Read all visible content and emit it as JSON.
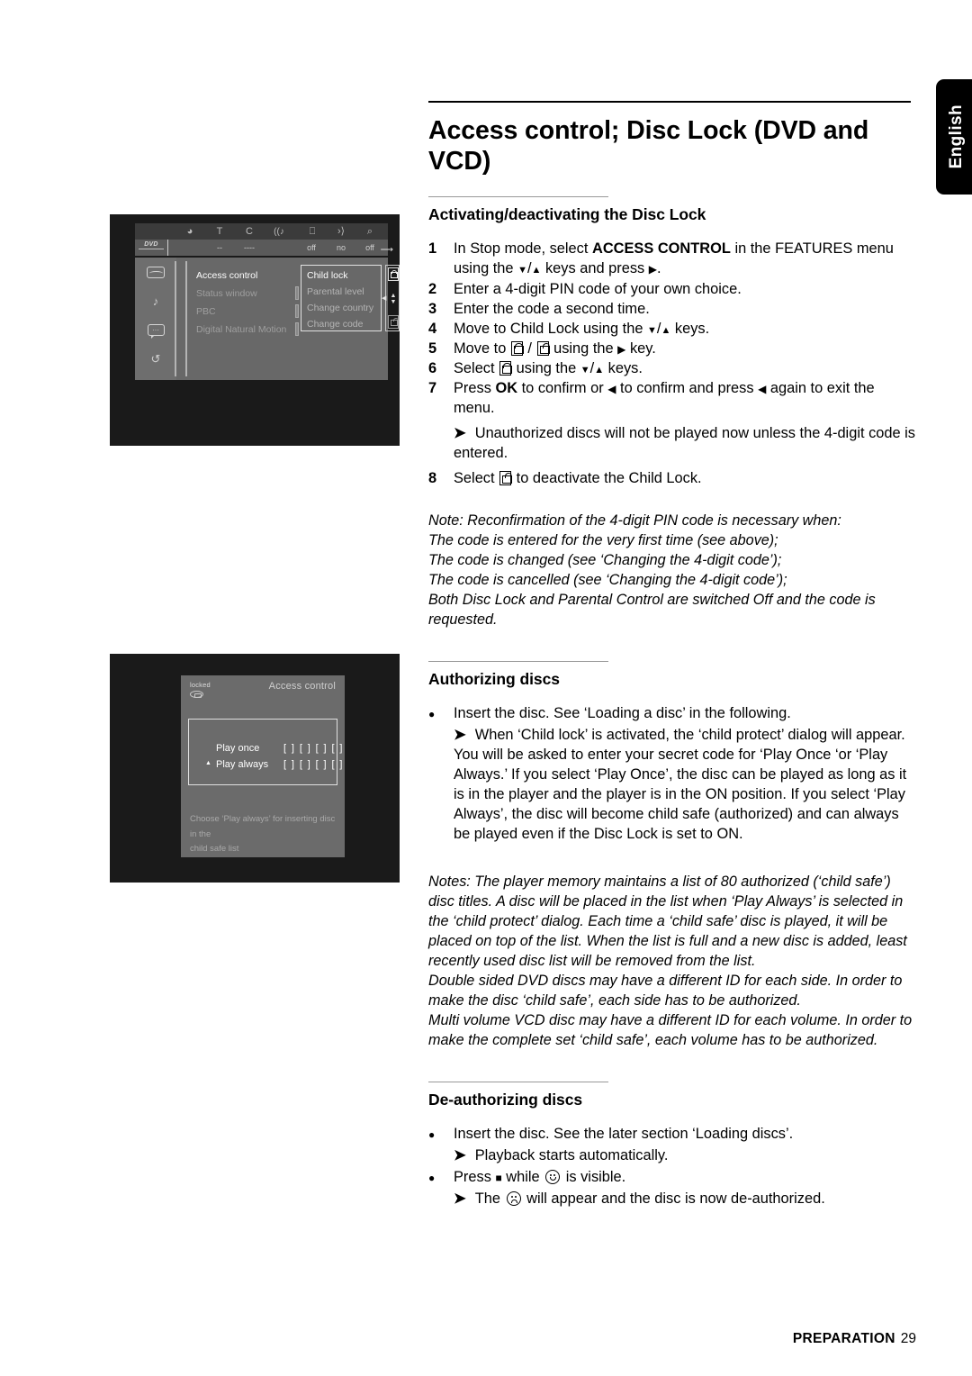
{
  "lang_tab": {
    "label": "English"
  },
  "title": "Access control; Disc Lock (DVD and VCD)",
  "sections": {
    "activating": {
      "heading": "Activating/deactivating the Disc Lock",
      "steps": [
        {
          "num": "1",
          "pre": "In Stop mode, select ",
          "bold": "ACCESS CONTROL",
          "post": " in the FEATURES menu using the ",
          "post2": " keys and press ",
          "post3": "."
        },
        {
          "num": "2",
          "text": "Enter a 4-digit PIN code of your own choice."
        },
        {
          "num": "3",
          "text": "Enter the code a second time."
        },
        {
          "num": "4",
          "pre": "Move to Child Lock using the ",
          "post": " keys."
        },
        {
          "num": "5",
          "pre": "Move to ",
          "mid": " / ",
          "post": " using the ",
          "post2": " key."
        },
        {
          "num": "6",
          "pre": "Select ",
          "post": " using the ",
          "post2": " keys."
        },
        {
          "num": "7",
          "pre": "Press ",
          "bold": "OK",
          "post": " to confirm or ",
          "post2": " to confirm and press ",
          "post3": " again to exit the menu."
        },
        {
          "num": "8",
          "pre": "Select ",
          "post": " to deactivate the Child Lock."
        }
      ],
      "step7_sub": "Unauthorized discs will not be played now unless the 4-digit code is entered.",
      "note_lines": [
        "Note: Reconfirmation of the 4-digit PIN code is necessary when:",
        "The code is entered for the very first time (see above);",
        "The code is changed (see ‘Changing the 4-digit code’);",
        "The code is cancelled (see ‘Changing the 4-digit code’);",
        "Both Disc Lock and Parental Control are switched Off and the code is requested."
      ]
    },
    "authorizing": {
      "heading": "Authorizing discs",
      "bullet": "Insert the disc. See ‘Loading a disc’ in the following.",
      "sub": "When ‘Child lock’ is activated, the ‘child protect’ dialog will appear. You will be asked to enter your secret code for ‘Play Once ‘or ‘Play Always.’ If you select ‘Play Once’, the disc can be played as long as it is in the player and the player is in the ON position. If you select ‘Play Always’, the disc will become child safe (authorized) and can always be played even if the Disc Lock is set to ON.",
      "notes": [
        "Notes: The player memory maintains a list of 80 authorized (‘child safe’) disc titles. A disc will be placed in the list when ‘Play Always’ is selected in the ‘child protect’ dialog. Each time a ‘child safe’ disc is played, it will be placed on top of the list. When the list is full and a new disc is added, least recently used disc list will be removed from the list.",
        "Double sided DVD discs may have a different ID for each side. In order to make the disc ‘child safe’, each side has to be authorized.",
        "Multi volume VCD disc may have a different ID for each volume. In order to make the complete set ‘child safe’, each volume has to be authorized."
      ]
    },
    "deauthorizing": {
      "heading": "De-authorizing discs",
      "bullet1": "Insert the disc. See the later section ‘Loading discs’.",
      "sub1": "Playback starts automatically.",
      "bullet2_pre": "Press ",
      "bullet2_mid": " while ",
      "bullet2_post": " is visible.",
      "sub2_pre": "The ",
      "sub2_post": " will appear and the disc is now de-authorized."
    }
  },
  "screenshot_menu": {
    "dvd_logo": "DVD",
    "toolbar_icons": [
      "disc-icon",
      "T",
      "C",
      "audio-icon",
      "subtitle-icon",
      "angle-icon",
      "zoom-icon"
    ],
    "toolbar_values": [
      "--",
      "----",
      "off",
      "no",
      "off"
    ],
    "sidebar_icons": [
      "picture-icon",
      "sound-icon",
      "language-icon",
      "features-icon"
    ],
    "menu_items": [
      "Access control",
      "Status window",
      "PBC",
      "Digital Natural Motion"
    ],
    "menu_active": "Access control",
    "submenu_items": [
      "Child lock",
      "Parental level",
      "Change country",
      "Change code"
    ],
    "submenu_active": "Child lock",
    "lock_states": [
      "locked",
      "unlocked"
    ]
  },
  "screenshot_dialog": {
    "locked_label": "locked",
    "title": "Access control",
    "options": [
      {
        "label": "Play once",
        "code": "[ ] [ ] [ ] [ ]",
        "selected": false
      },
      {
        "label": "Play always",
        "code": "[ ] [ ] [ ] [ ]",
        "selected": true
      }
    ],
    "footer_line1": "Choose ‘Play always’ for inserting disc in the",
    "footer_line2": "child safe list"
  },
  "footer": {
    "section": "PREPARATION",
    "page": "29"
  }
}
